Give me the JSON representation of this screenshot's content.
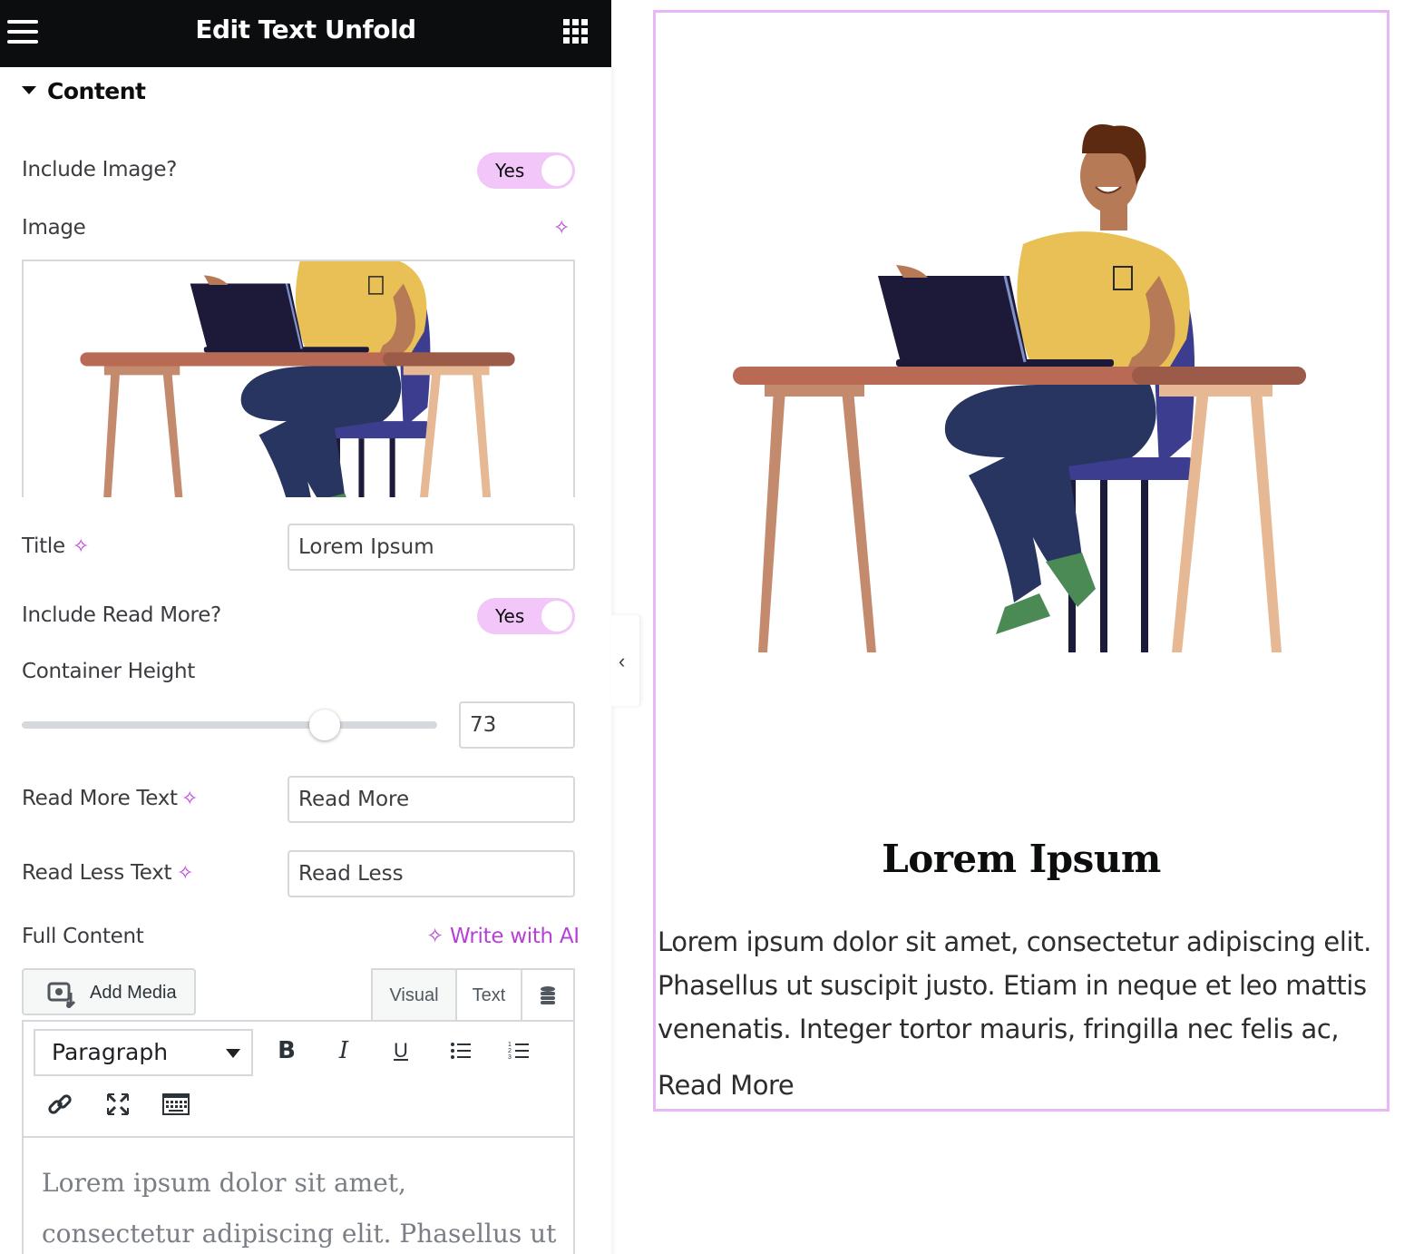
{
  "panel": {
    "title": "Edit Text Unfold",
    "section": "Content",
    "include_image": {
      "label": "Include Image?",
      "value": "Yes"
    },
    "image_label": "Image",
    "title_field": {
      "label": "Title",
      "value": "Lorem Ipsum"
    },
    "include_read_more": {
      "label": "Include Read More?",
      "value": "Yes"
    },
    "container_height": {
      "label": "Container Height",
      "value": "73"
    },
    "read_more_text": {
      "label": "Read More Text",
      "value": "Read More"
    },
    "read_less_text": {
      "label": "Read Less Text",
      "value": "Read Less"
    },
    "full_content": {
      "label": "Full Content",
      "write_ai": "Write with AI",
      "add_media": "Add Media",
      "tabs": {
        "visual": "Visual",
        "text": "Text"
      },
      "format": "Paragraph",
      "content": "Lorem ipsum dolor sit amet, consectetur adipiscing elit. Phasellus ut"
    }
  },
  "preview": {
    "title": "Lorem Ipsum",
    "body": "Lorem ipsum dolor sit amet, consectetur adipiscing elit. Phasellus ut suscipit justo. Etiam in neque et leo mattis venenatis. Integer tortor mauris, fringilla nec felis ac,",
    "read_more": "Read More"
  },
  "colors": {
    "accent": "#b73fd8",
    "toggle_on": "#f2c6f8",
    "frame_border": "#e8b8f5",
    "topbar": "#0c0d0e"
  },
  "icons": [
    "hamburger-menu-icon",
    "apps-grid-icon",
    "caret-down-icon",
    "ai-sparkle-icon",
    "add-media-icon",
    "database-icon",
    "bold-icon",
    "italic-icon",
    "underline-icon",
    "bullet-list-icon",
    "numbered-list-icon",
    "link-icon",
    "fullscreen-icon",
    "keyboard-icon",
    "chevron-left-icon"
  ]
}
